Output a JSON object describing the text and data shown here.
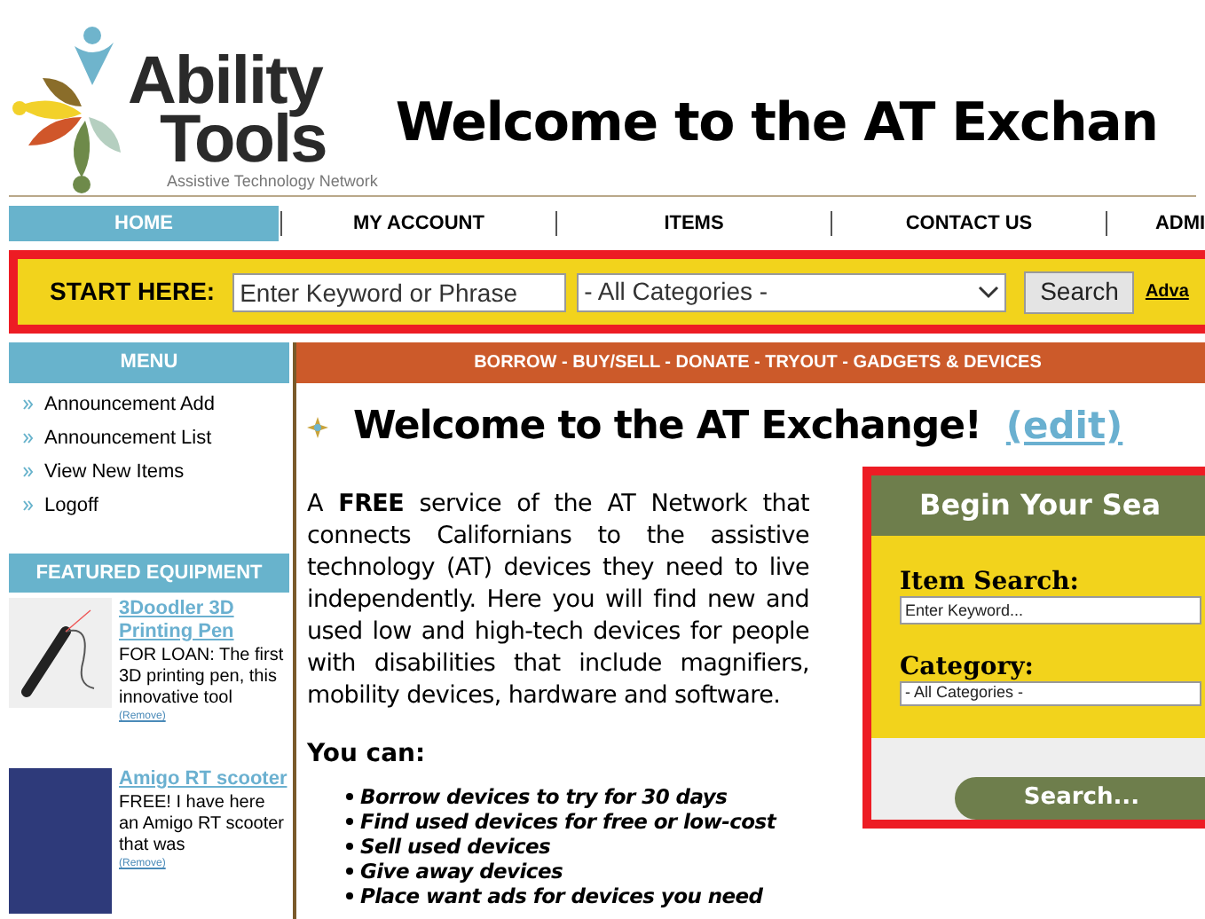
{
  "header": {
    "logo_name": "Ability",
    "logo_name_2": "Tools",
    "logo_tagline": "Assistive Technology Network",
    "title": "Welcome to the AT Exchan"
  },
  "nav": [
    {
      "label": "HOME",
      "selected": true
    },
    {
      "label": "MY ACCOUNT",
      "selected": false
    },
    {
      "label": "ITEMS",
      "selected": false
    },
    {
      "label": "CONTACT US",
      "selected": false
    },
    {
      "label": "ADMI",
      "selected": false
    }
  ],
  "search_bar": {
    "label": "START HERE:",
    "placeholder": "Enter Keyword or Phrase",
    "category": "- All Categories -",
    "button": "Search",
    "link": "Adva"
  },
  "menu": {
    "title": "MENU",
    "items": [
      "Announcement Add",
      "Announcement List",
      "View New Items",
      "Logoff"
    ]
  },
  "featured": {
    "title": "FEATURED EQUIPMENT",
    "items": [
      {
        "kind": "pen",
        "title": "3Doodler 3D Printing Pen",
        "text": "FOR LOAN: The first 3D printing pen, this innovative tool",
        "remove": "(Remove)"
      },
      {
        "kind": "scooter",
        "title": "Amigo RT scooter",
        "text": "FREE!  I have here an Amigo RT scooter that was",
        "remove": "(Remove)"
      }
    ]
  },
  "banner": "BORROW - BUY/SELL - DONATE - TRYOUT - GADGETS & DEVICES",
  "main": {
    "heading": "Welcome to the AT Exchange!",
    "edit_link": "(edit)",
    "intro": "A **FREE** service of the AT Network that connects Californians to the assistive technology (AT) devices they need to live independently. Here you will find new and used low and high-tech devices for people with disabilities that include magnifiers, mobility devices, hardware and software.",
    "you_can": "You can:",
    "list": [
      "Borrow devices to try for 30 days",
      "Find used devices for free or low-cost",
      "Sell used devices",
      "Give away devices",
      "Place want ads for devices you need"
    ]
  },
  "search_box": {
    "title": "Begin Your Sea",
    "item_label": "Item Search:",
    "item_placeholder": "Enter Keyword...",
    "category_label": "Category:",
    "category": "- All Categories -",
    "button": "Search..."
  }
}
